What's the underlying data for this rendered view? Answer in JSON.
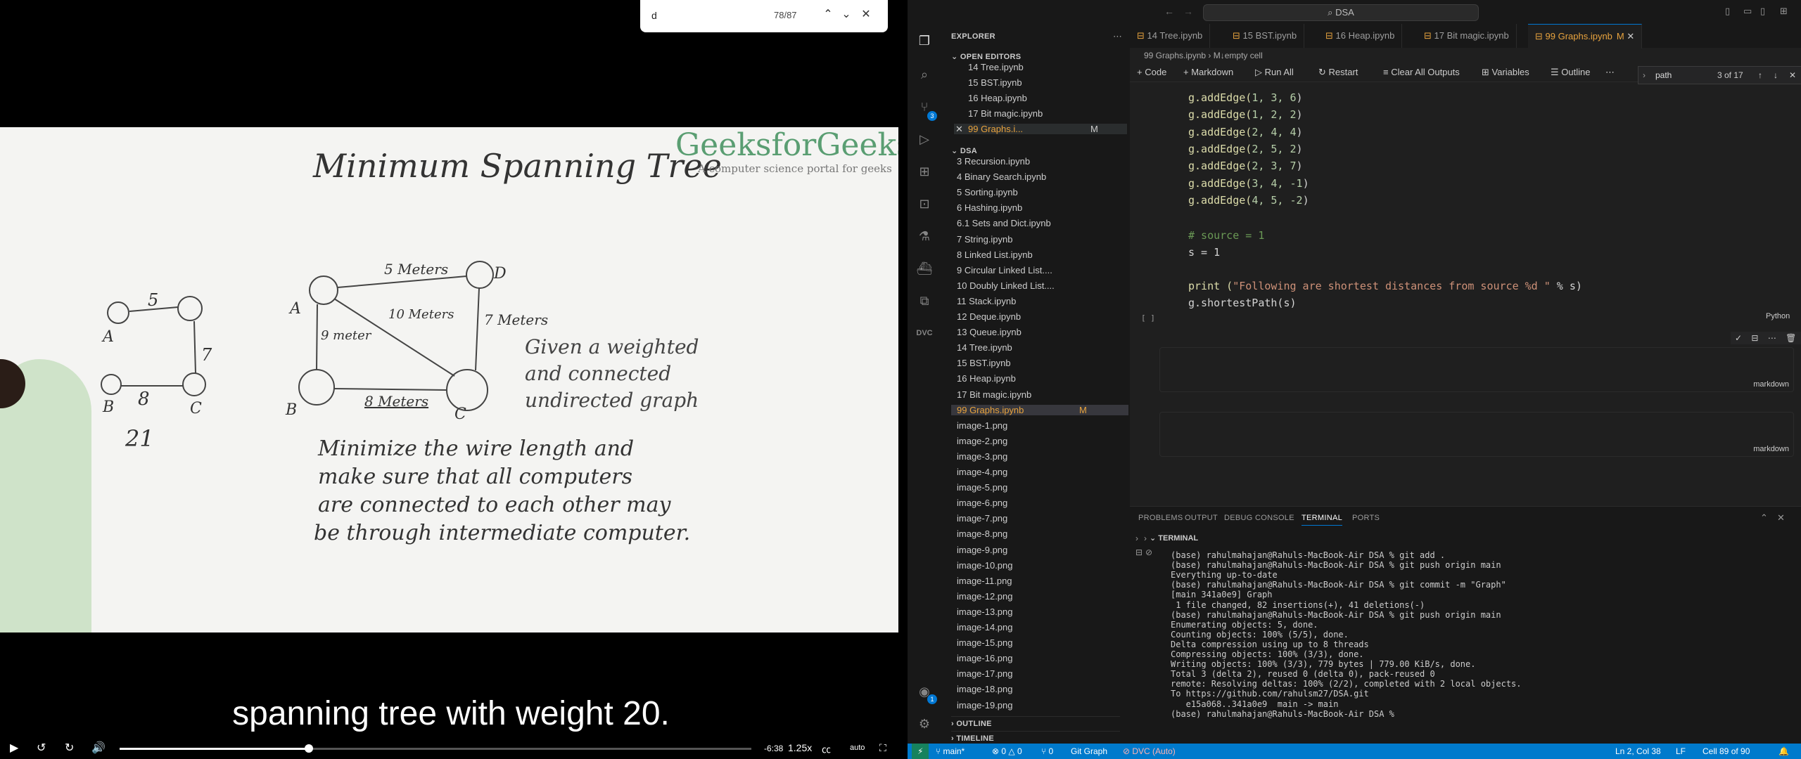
{
  "video": {
    "find": {
      "query": "d",
      "count": "78/87"
    },
    "board": {
      "title": "Minimum Spanning Tree",
      "logo_main": "GeeksforGeeks",
      "logo_sub": "A computer science portal for geeks",
      "left_graph": {
        "nodes": [
          "A",
          "B",
          "C"
        ],
        "edges": [
          "5",
          "7",
          "8"
        ],
        "sum": "21"
      },
      "right_graph": {
        "nodes": [
          "A",
          "B",
          "C",
          "D"
        ],
        "edges": [
          "5 Meters",
          "10 Meters",
          "7 Meters",
          "9 meter",
          "8 Meters"
        ]
      },
      "given_text": "Given a weighted and connected undirected graph",
      "goal_lines": [
        "Minimize the wire length and",
        "make sure that all computers",
        "are connected to each other may",
        "be through intermediate computer."
      ]
    },
    "caption": "spanning tree with weight 20.",
    "controls": {
      "time": "-6:38",
      "speed": "1.25x",
      "quality": "auto",
      "progress_percent": 30
    }
  },
  "vscode": {
    "command_center": "DSA",
    "explorer_title": "EXPLORER",
    "open_editors_title": "OPEN EDITORS",
    "open_editors": [
      "14 Tree.ipynb",
      "15 BST.ipynb",
      "16 Heap.ipynb",
      "17 Bit magic.ipynb",
      "99 Graphs.i..."
    ],
    "modified_badge": "M",
    "folder_title": "DSA",
    "files": [
      "3 Recursion.ipynb",
      "4 Binary Search.ipynb",
      "5 Sorting.ipynb",
      "6 Hashing.ipynb",
      "6.1 Sets and Dict.ipynb",
      "7 String.ipynb",
      "8 Linked List.ipynb",
      "9 Circular Linked List....",
      "10 Doubly Linked List....",
      "11 Stack.ipynb",
      "12 Deque.ipynb",
      "13 Queue.ipynb",
      "14 Tree.ipynb",
      "15 BST.ipynb",
      "16 Heap.ipynb",
      "17 Bit magic.ipynb",
      "99 Graphs.ipynb",
      "image-1.png",
      "image-2.png",
      "image-3.png",
      "image-4.png",
      "image-5.png",
      "image-6.png",
      "image-7.png",
      "image-8.png",
      "image-9.png",
      "image-10.png",
      "image-11.png",
      "image-12.png",
      "image-13.png",
      "image-14.png",
      "image-15.png",
      "image-16.png",
      "image-17.png",
      "image-18.png",
      "image-19.png"
    ],
    "outline_title": "OUTLINE",
    "timeline_title": "TIMELINE",
    "tabs": [
      "14 Tree.ipynb",
      "15 BST.ipynb",
      "16 Heap.ipynb",
      "17 Bit magic.ipynb",
      "99 Graphs.ipynb"
    ],
    "breadcrumb": [
      "99 Graphs.ipynb",
      "M↓empty cell"
    ],
    "toolbar": [
      "Code",
      "Markdown",
      "Run All",
      "Restart",
      "Clear All Outputs",
      "Variables",
      "Outline"
    ],
    "search": {
      "query": "path",
      "count": "3 of 17"
    },
    "code_lines": [
      {
        "pre": "g.addEdge(",
        "args": "1, 3, 6",
        "post": ")"
      },
      {
        "pre": "g.addEdge(",
        "args": "1, 2, 2",
        "post": ")"
      },
      {
        "pre": "g.addEdge(",
        "args": "2, 4, 4",
        "post": ")"
      },
      {
        "pre": "g.addEdge(",
        "args": "2, 5, 2",
        "post": ")"
      },
      {
        "pre": "g.addEdge(",
        "args": "2, 3, 7",
        "post": ")"
      },
      {
        "pre": "g.addEdge(",
        "args": "3, 4, -1",
        "post": ")"
      },
      {
        "pre": "g.addEdge(",
        "args": "4, 5, -2",
        "post": ")"
      }
    ],
    "comment_line": "# source = 1",
    "assign_line": "s = 1",
    "print_line": {
      "pre": "print (",
      "str": "\"Following are shortest distances from source %d \"",
      "post": " % s)"
    },
    "call_line": "g.shortestPath(s)",
    "cell_exec": "[ ]",
    "cell_lang": "Python",
    "markdown_label": "markdown",
    "panel_tabs": [
      "PROBLEMS",
      "OUTPUT",
      "DEBUG CONSOLE",
      "TERMINAL",
      "PORTS"
    ],
    "terminal_title": "TERMINAL",
    "terminal_lines": [
      "(base) rahulmahajan@Rahuls-MacBook-Air DSA % git add .",
      "(base) rahulmahajan@Rahuls-MacBook-Air DSA % git push origin main",
      "Everything up-to-date",
      "(base) rahulmahajan@Rahuls-MacBook-Air DSA % git commit -m \"Graph\"",
      "[main 341a0e9] Graph",
      " 1 file changed, 82 insertions(+), 41 deletions(-)",
      "(base) rahulmahajan@Rahuls-MacBook-Air DSA % git push origin main",
      "Enumerating objects: 5, done.",
      "Counting objects: 100% (5/5), done.",
      "Delta compression using up to 8 threads",
      "Compressing objects: 100% (3/3), done.",
      "Writing objects: 100% (3/3), 779 bytes | 779.00 KiB/s, done.",
      "Total 3 (delta 2), reused 0 (delta 0), pack-reused 0",
      "remote: Resolving deltas: 100% (2/2), completed with 2 local objects.",
      "To https://github.com/rahulsm27/DSA.git",
      "   e15a068..341a0e9  main -> main",
      "(base) rahulmahajan@Rahuls-MacBook-Air DSA % "
    ],
    "status": {
      "branch": "main*",
      "problems": "0 △ 0",
      "ports": "0",
      "git_graph": "Git Graph",
      "dvc": "DVC (Auto)",
      "position": "Ln 2, Col 38",
      "eol": "LF",
      "cell": "Cell 89 of 90"
    },
    "badges": {
      "scm": "3",
      "accounts": "1"
    }
  }
}
